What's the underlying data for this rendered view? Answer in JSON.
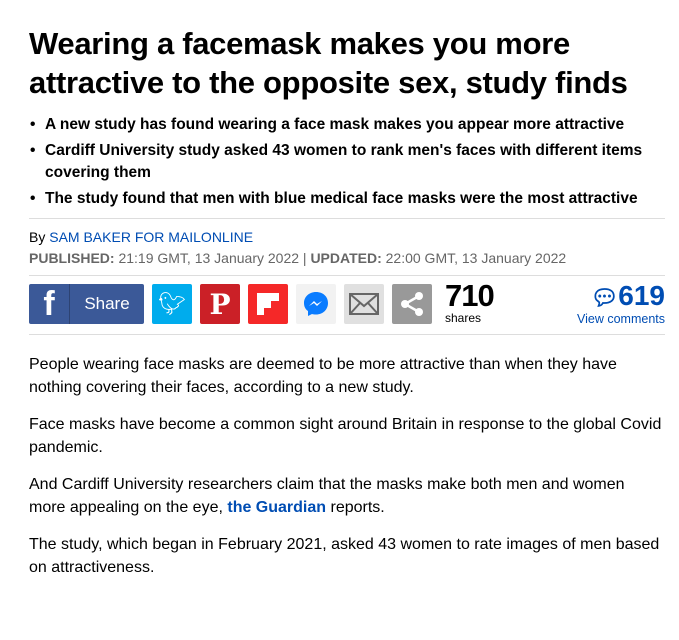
{
  "headline": "Wearing a facemask makes you more attractive to the opposite sex, study finds",
  "bullets": [
    "A new study has found wearing a face mask makes you appear more attractive",
    "Cardiff University study asked 43 women to rank men's faces with different items covering them",
    "The study found that men with blue medical face masks were the most attractive"
  ],
  "byline": {
    "prefix": "By ",
    "author": "SAM BAKER FOR MAILONLINE"
  },
  "meta": {
    "published_label": "PUBLISHED:",
    "published": " 21:19 GMT, 13 January 2022 | ",
    "updated_label": "UPDATED:",
    "updated": " 22:00 GMT, 13 January 2022"
  },
  "share": {
    "facebook_label": "Share",
    "count": "710",
    "count_label": "shares",
    "comments_count": "619",
    "comments_label": "View comments",
    "colors": {
      "facebook": "#3b5998",
      "twitter": "#00aced",
      "pinterest": "#cb2027",
      "flipboard": "#f52828",
      "messenger": "#f2f2f2",
      "email": "#e0e0e0",
      "more": "#999999"
    }
  },
  "body": {
    "p1": "People wearing face masks are deemed to be more attractive than when they have nothing covering their faces, according to a new study.",
    "p2": "Face masks have become a common sight around Britain in response to the global Covid pandemic.",
    "p3_pre": "And Cardiff University researchers claim that the masks make both men and women more appealing on the eye, ",
    "p3_link": "the Guardian",
    "p3_post": " reports.",
    "p4": "The study, which began in February 2021, asked 43 women to rate images of men based on attractiveness."
  }
}
